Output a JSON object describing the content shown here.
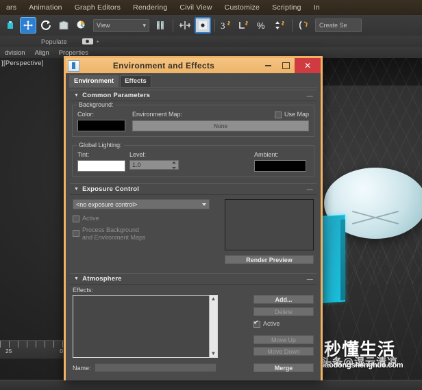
{
  "menubar": {
    "items": [
      "ars",
      "Animation",
      "Graph Editors",
      "Rendering",
      "Civil View",
      "Customize",
      "Scripting",
      "In"
    ]
  },
  "toolbar": {
    "view_dropdown": "View",
    "create_set": "Create Se"
  },
  "bar2": {
    "populate_label": "Populate"
  },
  "bar3": {
    "items": [
      "dvision",
      "Align",
      "Properties"
    ]
  },
  "viewport": {
    "label": "][Perspective]",
    "timeline_tick_left": "25",
    "timeline_tick_right": "0"
  },
  "watermark": {
    "cn_main": "秒懂生活",
    "cn_sub": "头条@湿云清凉",
    "url": "miaodongshenghuo.com"
  },
  "dialog": {
    "title": "Environment and Effects",
    "minimize": "–",
    "maximize": "□",
    "close": "✕",
    "tabs": [
      {
        "label": "Environment",
        "active": true
      },
      {
        "label": "Effects",
        "active": false
      }
    ],
    "common_parameters": {
      "header": "Common Parameters",
      "background_group": "Background:",
      "color_label": "Color:",
      "color_value": "#000000",
      "env_map_label": "Environment Map:",
      "env_map_button": "None",
      "use_map_label": "Use Map",
      "use_map_checked": false,
      "global_lighting_group": "Global Lighting:",
      "tint_label": "Tint:",
      "tint_value": "#ffffff",
      "level_label": "Level:",
      "level_value": "1.0",
      "ambient_label": "Ambient:",
      "ambient_value": "#000000"
    },
    "exposure_control": {
      "header": "Exposure Control",
      "selected": "<no exposure control>",
      "active_label": "Active",
      "active_checked": false,
      "preview_label_line1": "Process Background",
      "preview_label_line2": "and Environment Maps",
      "preview_checked": false,
      "render_preview_button": "Render Preview"
    },
    "atmosphere": {
      "header": "Atmosphere",
      "effects_label": "Effects:",
      "effects_items": [],
      "add_button": "Add...",
      "delete_button": "Delete",
      "active_label": "Active",
      "active_checked": true,
      "move_up_button": "Move Up",
      "move_down_button": "Move Down",
      "name_label": "Name:",
      "name_value": "",
      "merge_button": "Merge"
    }
  },
  "colors": {
    "dialog_border": "#f2b264",
    "title_bar": "#eeb469",
    "close_button": "#cf3b41",
    "panel_bg": "#4a4a4a",
    "accent_blue": "#2f7fd1",
    "object_cyan": "#18c4e0"
  }
}
